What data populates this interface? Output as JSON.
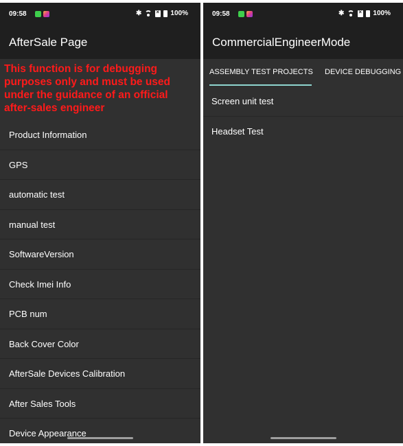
{
  "status_bar": {
    "time": "09:58",
    "battery": "100%"
  },
  "left_screen": {
    "title": "AfterSale Page",
    "warning": "This function is for debugging purposes only and must be used under the guidance of an official after-sales engineer",
    "menu_items": [
      "Product Information",
      "GPS",
      "automatic test",
      "manual test",
      "SoftwareVersion",
      "Check Imei Info",
      "PCB num",
      "Back Cover Color",
      "AfterSale Devices Calibration",
      "After Sales Tools",
      "Device Appearance"
    ]
  },
  "right_screen": {
    "title": "CommercialEngineerMode",
    "tabs": [
      "ASSEMBLY TEST PROJECTS",
      "DEVICE DEBUGGING"
    ],
    "selected_tab": "ASSEMBLY TEST PROJECTS",
    "list_items": [
      "Screen unit test",
      "Headset Test"
    ]
  },
  "colors": {
    "background": "#303030",
    "appbar": "#1f1f1f",
    "warning_text": "#ff1a1a",
    "tab_indicator": "#8fd6d0"
  }
}
